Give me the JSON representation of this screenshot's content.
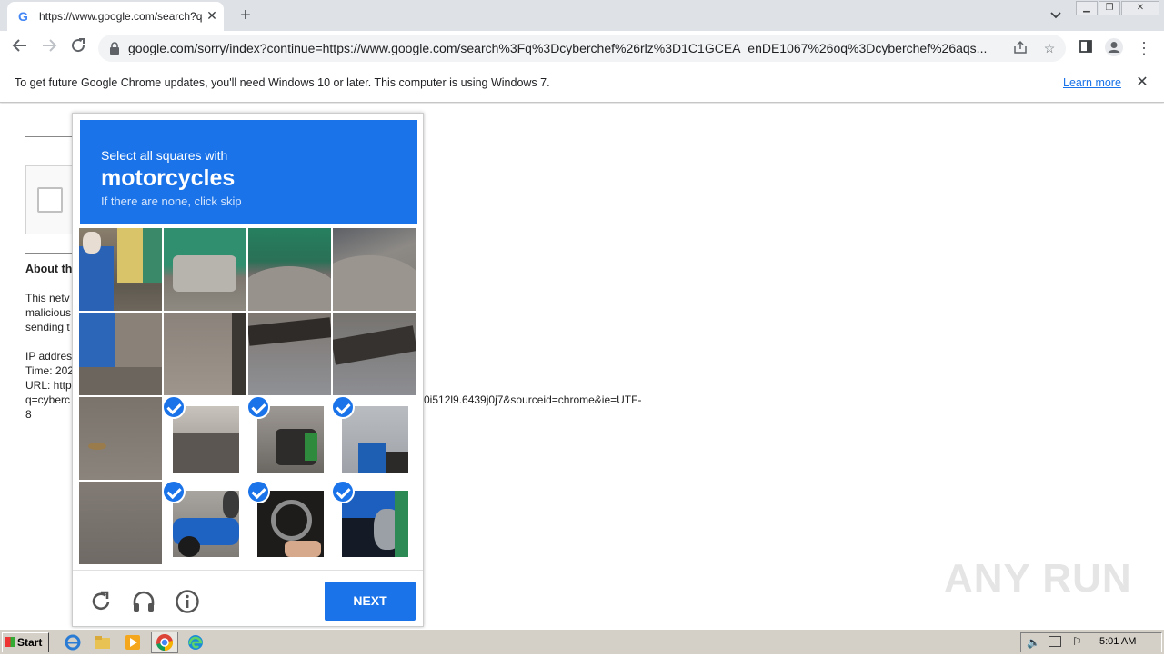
{
  "browser": {
    "tab_title": "https://www.google.com/search?q=",
    "tab_close": "✕",
    "new_tab": "+",
    "url": "google.com/sorry/index?continue=https://www.google.com/search%3Fq%3Dcyberchef%26rlz%3D1C1GCEA_enDE1067%26oq%3Dcyberchef%26aqs..."
  },
  "infobar": {
    "message": "To get future Google Chrome updates, you'll need Windows 10 or later. This computer is using Windows 7.",
    "link": "Learn more",
    "close": "✕"
  },
  "page": {
    "about_heading": "About th",
    "para_lines": [
      "This netv",
      "malicious",
      "sending t"
    ],
    "info_lines": [
      "IP addres",
      "Time: 202",
      "URL: http",
      "q=cyberc",
      "8"
    ],
    "url_tail": "0i512l9.6439j0j7&sourceid=chrome&ie=UTF-"
  },
  "captcha": {
    "instruction": "Select all squares with",
    "target": "motorcycles",
    "hint": "If there are none, click skip",
    "selected_tiles": [
      7,
      8,
      9,
      13,
      14,
      15
    ],
    "next_label": "NEXT"
  },
  "watermark": "ANY RUN",
  "taskbar": {
    "start_label": "Start",
    "clock": "5:01 AM"
  },
  "colors": {
    "accent": "#1a73e8",
    "header_bg": "#dee1e6",
    "taskbar_bg": "#d4d0c8"
  }
}
